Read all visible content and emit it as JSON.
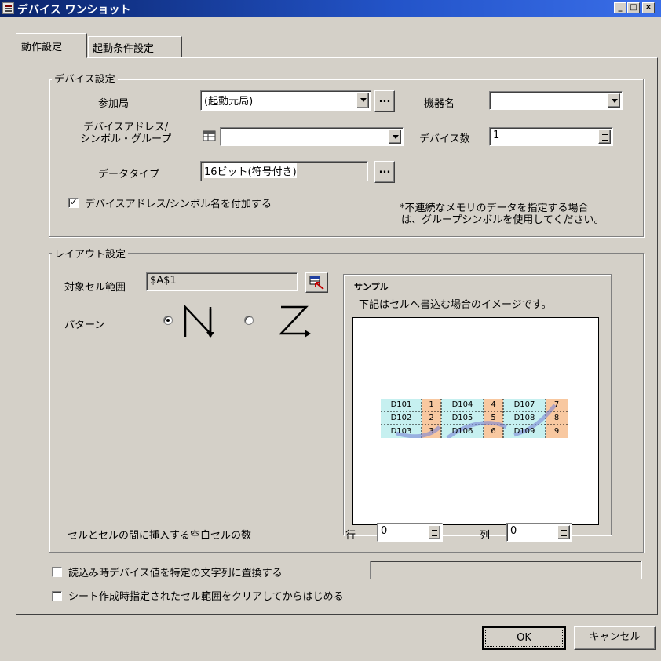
{
  "window": {
    "title": "デバイス ワンショット"
  },
  "tabs": [
    {
      "label": "動作設定"
    },
    {
      "label": "起動条件設定"
    }
  ],
  "device_settings": {
    "group_title": "デバイス設定",
    "station_label": "参加局",
    "station_value": "(起動元局)",
    "machine_label": "機器名",
    "machine_value": "",
    "address_label_line1": "デバイスアドレス/",
    "address_label_line2": "シンボル・グループ",
    "address_value": "",
    "count_label": "デバイス数",
    "count_value": "1",
    "datatype_label": "データタイプ",
    "datatype_value": "16ビット(符号付き)",
    "ellipsis": "...",
    "append_checkbox_label": "デバイスアドレス/シンボル名を付加する",
    "append_checked": true,
    "note_line1": "*不連続なメモリのデータを指定する場合",
    "note_line2": "は、グループシンボルを使用してください。"
  },
  "layout_settings": {
    "group_title": "レイアウト設定",
    "cell_range_label": "対象セル範囲",
    "cell_range_value": "$A$1",
    "pattern_label": "パターン",
    "pattern_selected": "vertical",
    "sample": {
      "title": "サンプル",
      "caption": "下記はセルへ書込む場合のイメージです。",
      "colors": {
        "device_cell": "#c6f0f0",
        "value_cell": "#f8c8a0",
        "arrow": "#7b86d6"
      },
      "rows": [
        [
          "D101",
          "1",
          "D104",
          "4",
          "D107",
          "7"
        ],
        [
          "D102",
          "2",
          "D105",
          "5",
          "D108",
          "8"
        ],
        [
          "D103",
          "3",
          "D106",
          "6",
          "D109",
          "9"
        ]
      ]
    },
    "blank_cells_label": "セルとセルの間に挿入する空白セルの数",
    "row_label": "行",
    "row_value": "0",
    "col_label": "列",
    "col_value": "0"
  },
  "options": {
    "replace_label": "読込み時デバイス値を特定の文字列に置換する",
    "replace_checked": false,
    "replace_value": "",
    "clear_label": "シート作成時指定されたセル範囲をクリアしてからはじめる",
    "clear_checked": false
  },
  "buttons": {
    "ok": "OK",
    "cancel": "キャンセル"
  }
}
